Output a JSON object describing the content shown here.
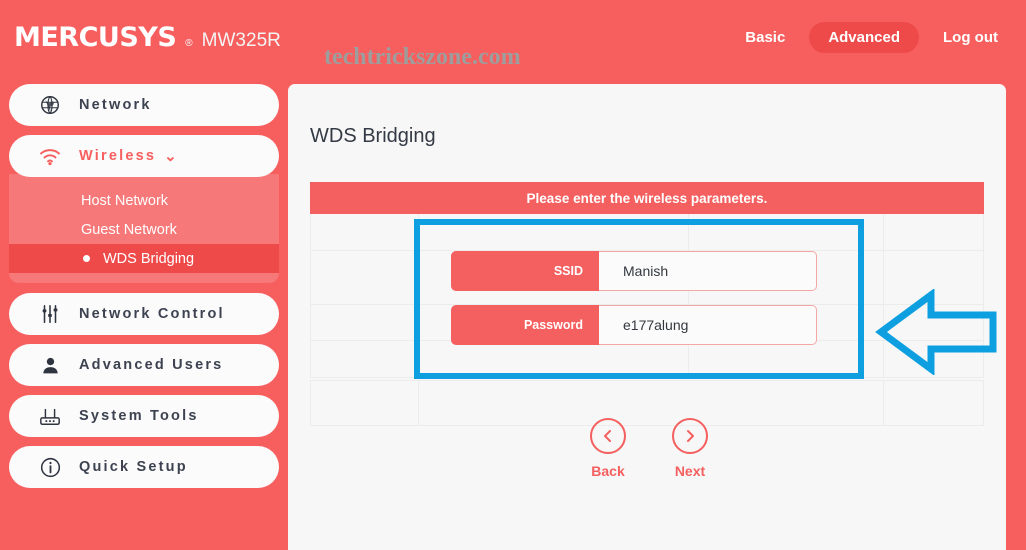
{
  "header": {
    "brand": "MERCUSYS",
    "brand_reg": "®",
    "model": "MW325R",
    "watermark": "techtrickszone.com",
    "nav": [
      {
        "label": "Basic",
        "active": false
      },
      {
        "label": "Advanced",
        "active": true
      },
      {
        "label": "Log out",
        "active": false
      }
    ]
  },
  "sidebar": {
    "items": [
      {
        "label": "Network",
        "icon": "globe-icon"
      },
      {
        "label": "Wireless",
        "icon": "wifi-icon",
        "expanded": true,
        "chevron": "⌄"
      },
      {
        "label": "Network Control",
        "icon": "sliders-icon"
      },
      {
        "label": "Advanced Users",
        "icon": "user-icon"
      },
      {
        "label": "System Tools",
        "icon": "router-icon"
      },
      {
        "label": "Quick Setup",
        "icon": "info-circle-icon"
      }
    ],
    "submenu": [
      {
        "label": "Host Network",
        "active": false
      },
      {
        "label": "Guest Network",
        "active": false
      },
      {
        "label": "WDS Bridging",
        "active": true
      }
    ]
  },
  "main": {
    "title": "WDS Bridging",
    "banner": "Please enter the wireless parameters.",
    "fields": [
      {
        "label": "SSID",
        "value": "Manish"
      },
      {
        "label": "Password",
        "value": "e177alung"
      }
    ],
    "buttons": [
      {
        "label": "Back",
        "icon": "chevron-left-icon"
      },
      {
        "label": "Next",
        "icon": "chevron-right-icon"
      }
    ]
  },
  "annotation": {
    "rect_color": "#0d9fe0",
    "arrow_color": "#0d9fe0",
    "arrow_direction": "left"
  },
  "colors": {
    "brand_red": "#f75f5f",
    "active_red": "#ee4a4a",
    "submenu_red": "#f77878",
    "content_bg": "#f7f7f7",
    "annotation_blue": "#0d9fe0"
  }
}
